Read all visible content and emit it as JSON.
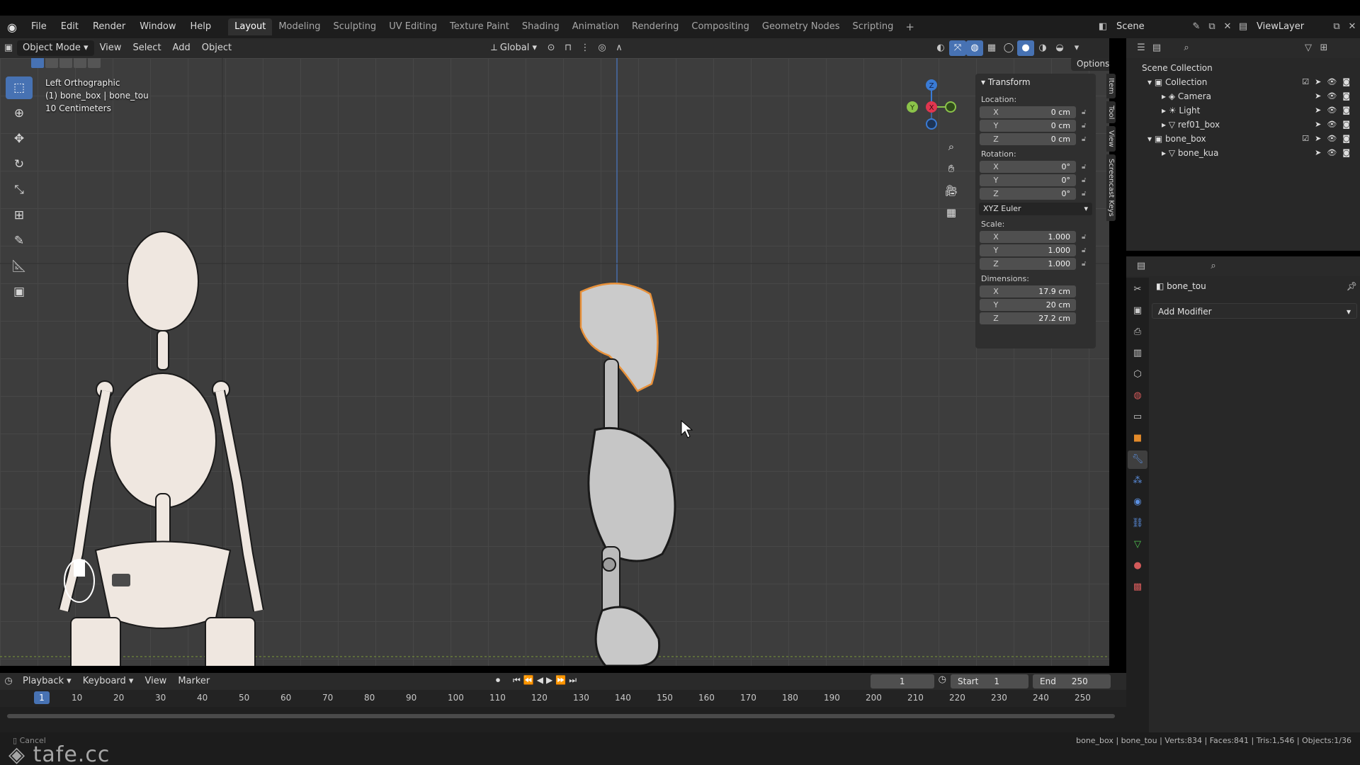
{
  "app": {
    "menus": [
      "File",
      "Edit",
      "Render",
      "Window",
      "Help"
    ],
    "workspace_tabs": [
      "Layout",
      "Modeling",
      "Sculpting",
      "UV Editing",
      "Texture Paint",
      "Shading",
      "Animation",
      "Rendering",
      "Compositing",
      "Geometry Nodes",
      "Scripting"
    ],
    "active_tab": "Layout",
    "scene_name": "Scene",
    "view_layer": "ViewLayer"
  },
  "viewport_header": {
    "mode": "Object Mode",
    "menus": [
      "View",
      "Select",
      "Add",
      "Object"
    ],
    "orientation": "Global",
    "options_label": "Options"
  },
  "viewport": {
    "view_name": "Left Orthographic",
    "active_object": "(1) bone_box | bone_tou",
    "grid_scale": "10 Centimeters",
    "gizmo_axes": [
      "X",
      "Y",
      "Z"
    ]
  },
  "toolbar": {
    "tools": [
      "select-box-icon",
      "cursor-icon",
      "move-icon",
      "rotate-icon",
      "scale-icon",
      "transform-icon",
      "annotate-icon",
      "measure-icon",
      "add-cube-icon"
    ]
  },
  "npanel": {
    "section": "Transform",
    "location_label": "Location:",
    "location": [
      {
        "axis": "X",
        "value": "0 cm"
      },
      {
        "axis": "Y",
        "value": "0 cm"
      },
      {
        "axis": "Z",
        "value": "0 cm"
      }
    ],
    "rotation_label": "Rotation:",
    "rotation": [
      {
        "axis": "X",
        "value": "0°"
      },
      {
        "axis": "Y",
        "value": "0°"
      },
      {
        "axis": "Z",
        "value": "0°"
      }
    ],
    "rotation_mode": "XYZ Euler",
    "scale_label": "Scale:",
    "scale": [
      {
        "axis": "X",
        "value": "1.000"
      },
      {
        "axis": "Y",
        "value": "1.000"
      },
      {
        "axis": "Z",
        "value": "1.000"
      }
    ],
    "dimensions_label": "Dimensions:",
    "dimensions": [
      {
        "axis": "X",
        "value": "17.9 cm"
      },
      {
        "axis": "Y",
        "value": "20 cm"
      },
      {
        "axis": "Z",
        "value": "27.2 cm"
      }
    ],
    "tabs": [
      "Item",
      "Tool",
      "View",
      "Screencast Keys"
    ]
  },
  "outliner": {
    "root": "Scene Collection",
    "rows": [
      {
        "name": "Collection",
        "level": 1
      },
      {
        "name": "Camera",
        "level": 2
      },
      {
        "name": "Light",
        "level": 2
      },
      {
        "name": "ref01_box",
        "level": 2
      },
      {
        "name": "bone_box",
        "level": 1
      },
      {
        "name": "bone_kua",
        "level": 2
      }
    ]
  },
  "properties": {
    "object_name": "bone_tou",
    "add_modifier": "Add Modifier"
  },
  "timeline": {
    "menus": [
      "Playback",
      "Keyboard",
      "View",
      "Marker"
    ],
    "current_frame": "1",
    "start_label": "Start",
    "start": "1",
    "end_label": "End",
    "end": "250",
    "ticks": [
      "10",
      "20",
      "30",
      "40",
      "50",
      "60",
      "70",
      "80",
      "90",
      "100",
      "110",
      "120",
      "130",
      "140",
      "150",
      "160",
      "170",
      "180",
      "190",
      "200",
      "210",
      "220",
      "230",
      "240",
      "250"
    ]
  },
  "statusbar": {
    "left": "Cancel",
    "right": "bone_box | bone_tou | Verts:834 | Faces:841 | Tris:1,546 | Objects:1/36",
    "watermark": "tafe.cc"
  },
  "colors": {
    "accent": "#4772b3",
    "selection_outline": "#e8913a",
    "axis_x": "#e0364f",
    "axis_y": "#8bc34a",
    "axis_z": "#3a7bd5"
  }
}
